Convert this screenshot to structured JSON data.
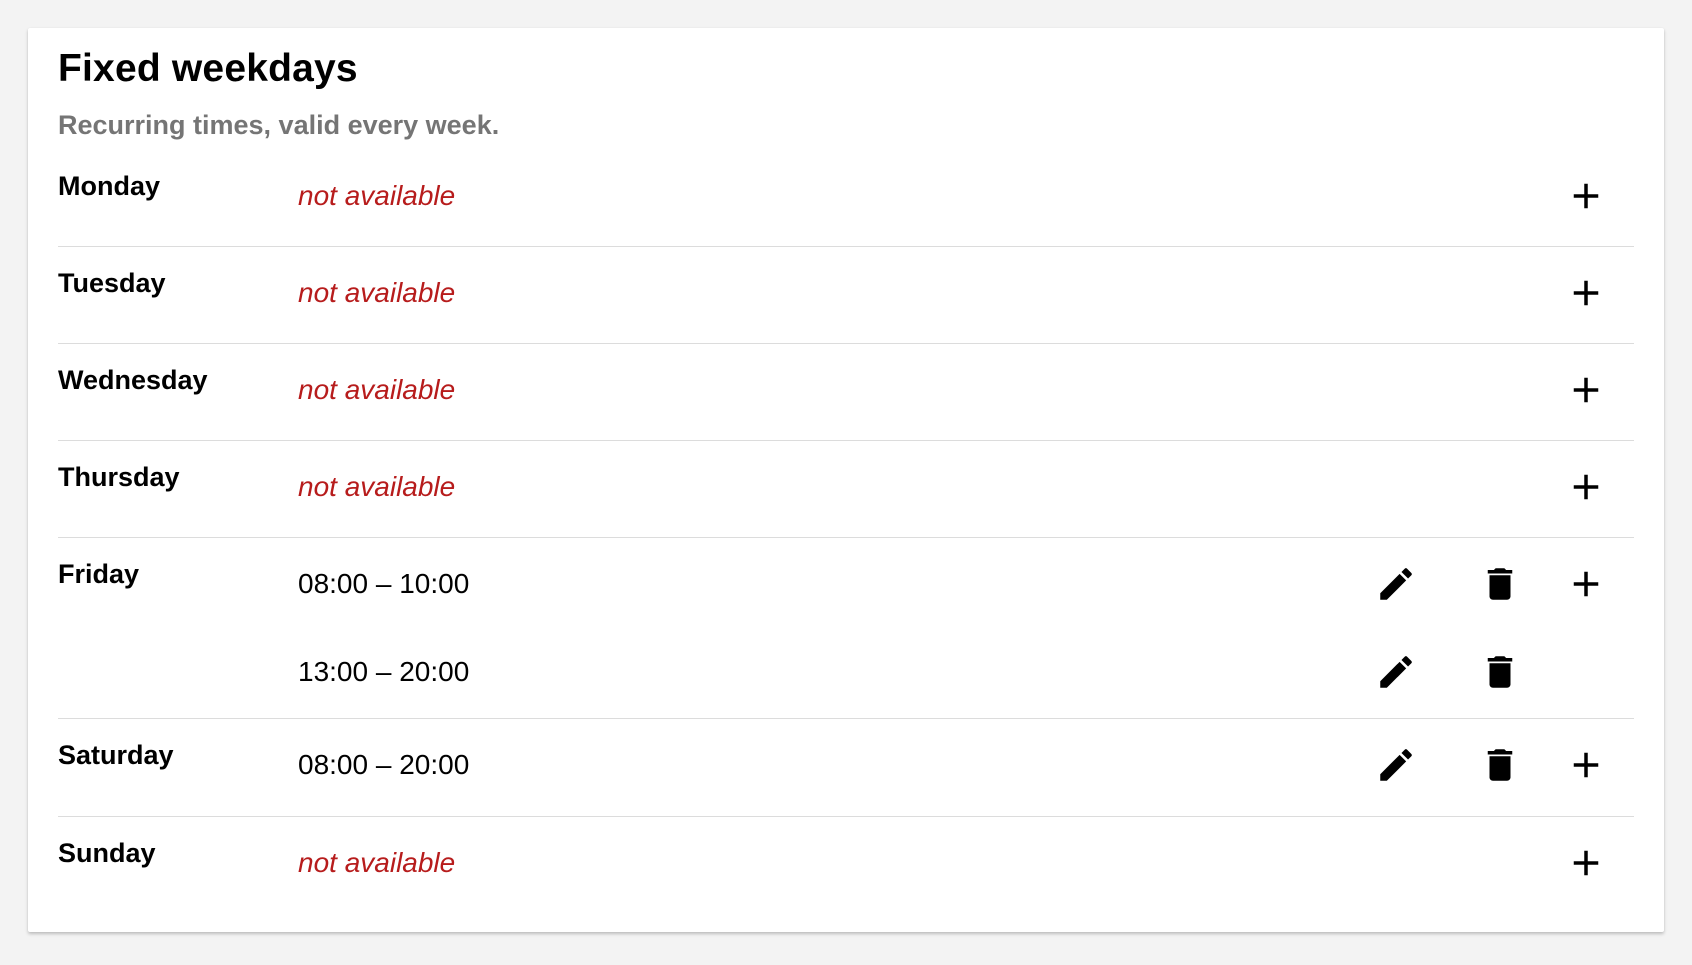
{
  "section": {
    "title": "Fixed weekdays",
    "subtitle": "Recurring times, valid every week."
  },
  "days": [
    {
      "name": "Monday",
      "slots": [
        {
          "text": "not available",
          "available": false
        }
      ]
    },
    {
      "name": "Tuesday",
      "slots": [
        {
          "text": "not available",
          "available": false
        }
      ]
    },
    {
      "name": "Wednesday",
      "slots": [
        {
          "text": "not available",
          "available": false
        }
      ]
    },
    {
      "name": "Thursday",
      "slots": [
        {
          "text": "not available",
          "available": false
        }
      ]
    },
    {
      "name": "Friday",
      "slots": [
        {
          "text": "08:00 – 10:00",
          "available": true
        },
        {
          "text": "13:00 – 20:00",
          "available": true
        }
      ]
    },
    {
      "name": "Saturday",
      "slots": [
        {
          "text": "08:00 – 20:00",
          "available": true
        }
      ]
    },
    {
      "name": "Sunday",
      "slots": [
        {
          "text": "not available",
          "available": false
        }
      ]
    }
  ],
  "icons": {
    "add": "plus-icon",
    "edit": "pencil-icon",
    "delete": "trash-icon"
  },
  "colors": {
    "not_available": "#b71c1c",
    "subtitle": "#757575",
    "divider": "#dcdcdc",
    "page_background": "#f3f3f3",
    "card_background": "#ffffff"
  }
}
